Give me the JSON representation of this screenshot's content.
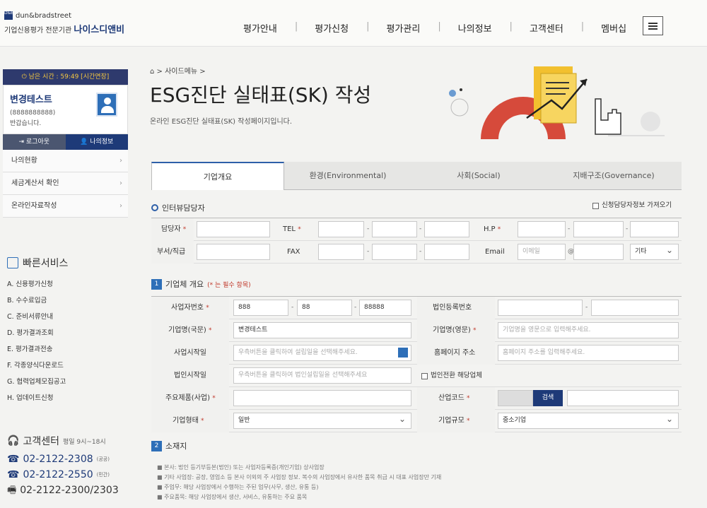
{
  "brand": {
    "logo_text": "dun&bradstreet",
    "tagline": "기업신용평가 전문기관",
    "name": "나이스디앤비"
  },
  "gnb": [
    "평가안내",
    "평가신청",
    "평가관리",
    "나의정보",
    "고객센터",
    "멤버십"
  ],
  "sidebar": {
    "timer": "남은 시간 : 59:49 [시간연장]",
    "user_name": "변경테스트",
    "user_id": "(8888888888)",
    "greeting": "반갑습니다.",
    "logout": "로그아웃",
    "myinfo": "나의정보",
    "menu": [
      "나의현황",
      "세금계산서 확인",
      "온라인자료작성"
    ]
  },
  "quick": {
    "title": "빠른서비스",
    "items": [
      "A. 신용평가신청",
      "B. 수수료입금",
      "C. 준비서류안내",
      "D. 평가결과조회",
      "E. 평가결과전송",
      "F. 각종양식다운로드",
      "G. 협력업체모집공고",
      "H. 업데이트신청"
    ]
  },
  "cs": {
    "title": "고객센터",
    "hours": "평일 9시~18시",
    "phones": [
      {
        "num": "02-2122-2308",
        "tag": "(공공)"
      },
      {
        "num": "02-2122-2550",
        "tag": "(민간)"
      },
      {
        "num": "02-2122-2300/2303",
        "tag": ""
      }
    ]
  },
  "page": {
    "breadcrumb": "> 사이드메뉴 >",
    "title": "ESG진단 실태표(SK) 작성",
    "desc": "온라인 ESG진단 실태표(SK) 작성페이지입니다."
  },
  "tabs": [
    "기업개요",
    "환경(Environmental)",
    "사회(Social)",
    "지배구조(Governance)"
  ],
  "interview": {
    "title": "인터뷰담당자",
    "load": "신청담당자정보 가져오기",
    "l_person": "담당자",
    "l_tel": "TEL",
    "l_hp": "H.P",
    "l_dept": "부서/직급",
    "l_fax": "FAX",
    "l_email": "Email",
    "email_ph": "이메일",
    "email_domain": "기타"
  },
  "company": {
    "num": "1",
    "title": "기업체 개요",
    "req": "(* 는 필수 항목)",
    "l_bizno": "사업자번호",
    "biz1": "888",
    "biz2": "88",
    "biz3": "88888",
    "l_corpno": "법인등록번호",
    "l_name_kr": "기업명(국문)",
    "name_kr": "변경테스트",
    "l_name_en": "기업명(영문)",
    "name_en_ph": "기업명을 영문으로 입력해주세요.",
    "l_start": "사업시작일",
    "start_ph": "우측버튼을 클릭하여 설립일을 선택해주세요.",
    "l_home": "홈페이지 주소",
    "home_ph": "홈페이지 주소를 입력해주세요.",
    "l_corp_start": "법인시작일",
    "corp_start_ph": "우측버튼을 클릭하여 법인설립일을 선택해주세요",
    "corp_convert": "법인전환 해당업체",
    "l_product": "주요제품(사업)",
    "l_industry": "산업코드",
    "search": "검색",
    "l_type": "기업형태",
    "type": "일반",
    "l_size": "기업규모",
    "size": "중소기업"
  },
  "location": {
    "num": "2",
    "title": "소재지",
    "notes": [
      "■ 본사: 법인 등기부등본(법인) 또는 사업자등록증(개인기업) 상사업장",
      "■ 기타 사업장: 공장, 영업소 등 본사 이외의 주 사업장 정보. 복수의 사업장에서 유사한 품목 취급 시 대표 사업장만 기재",
      "■ 주업무: 해당 사업장에서 수행하는 주된 업무(사무, 생산, 유통 등)",
      "■ 주요품목: 해당 사업장에서 생산, 서비스, 유통하는 주요 품목"
    ]
  }
}
